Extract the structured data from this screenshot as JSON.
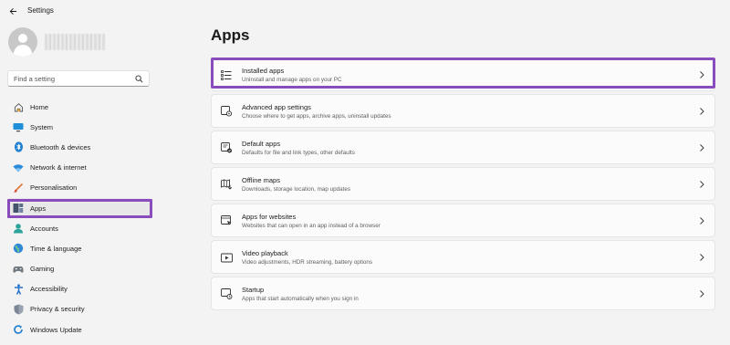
{
  "window": {
    "title": "Settings"
  },
  "search": {
    "placeholder": "Find a setting"
  },
  "sidebar": {
    "items": [
      {
        "label": "Home",
        "icon": "home-icon"
      },
      {
        "label": "System",
        "icon": "system-icon"
      },
      {
        "label": "Bluetooth & devices",
        "icon": "bluetooth-icon"
      },
      {
        "label": "Network & internet",
        "icon": "wifi-icon"
      },
      {
        "label": "Personalisation",
        "icon": "brush-icon"
      },
      {
        "label": "Apps",
        "icon": "apps-icon",
        "active": true
      },
      {
        "label": "Accounts",
        "icon": "account-icon"
      },
      {
        "label": "Time & language",
        "icon": "globe-icon"
      },
      {
        "label": "Gaming",
        "icon": "gamepad-icon"
      },
      {
        "label": "Accessibility",
        "icon": "accessibility-icon"
      },
      {
        "label": "Privacy & security",
        "icon": "shield-icon"
      },
      {
        "label": "Windows Update",
        "icon": "update-icon"
      }
    ]
  },
  "main": {
    "title": "Apps",
    "cards": [
      {
        "title": "Installed apps",
        "description": "Uninstall and manage apps on your PC",
        "icon": "list-icon"
      },
      {
        "title": "Advanced app settings",
        "description": "Choose where to get apps, archive apps, uninstall updates",
        "icon": "app-settings-icon"
      },
      {
        "title": "Default apps",
        "description": "Defaults for file and link types, other defaults",
        "icon": "default-apps-icon"
      },
      {
        "title": "Offline maps",
        "description": "Downloads, storage location, map updates",
        "icon": "map-icon"
      },
      {
        "title": "Apps for websites",
        "description": "Websites that can open in an app instead of a browser",
        "icon": "web-app-icon"
      },
      {
        "title": "Video playback",
        "description": "Video adjustments, HDR streaming, battery options",
        "icon": "video-icon"
      },
      {
        "title": "Startup",
        "description": "Apps that start automatically when you sign in",
        "icon": "startup-icon"
      }
    ]
  },
  "colors": {
    "highlight": "#8a4bbd",
    "accent": "#0067c0"
  }
}
